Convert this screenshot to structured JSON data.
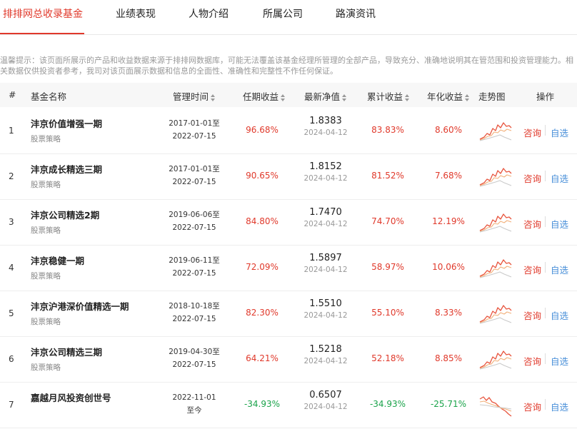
{
  "tabs": [
    {
      "label": "排排网总收录基金",
      "active": true
    },
    {
      "label": "业绩表现",
      "active": false
    },
    {
      "label": "人物介绍",
      "active": false
    },
    {
      "label": "所属公司",
      "active": false
    },
    {
      "label": "路演资讯",
      "active": false
    }
  ],
  "notice": {
    "line1": "温馨提示：该页面所展示的产品和收益数据来源于排排网数据库，可能无法覆盖该基金经理所管理的全部产品，导致充分、准确地说明其在管范围和投资管理能力。相",
    "line2": "关数据仅供投资者参考，我司对该页面展示数据和信息的全面性、准确性和完整性不作任何保证。"
  },
  "columns": {
    "index": "#",
    "fund_name": "基金名称",
    "period": "管理时间",
    "tenure_return": "任期收益",
    "nav": "最新净值",
    "cumulative": "累计收益",
    "annualized": "年化收益",
    "trend": "走势图",
    "action": "操作"
  },
  "colors": {
    "accent": "#e0392b",
    "up": "#e0392b",
    "down": "#1aa34a",
    "link": "#4a90d9"
  },
  "rows": [
    {
      "index": "1",
      "name": "沣京价值增强一期",
      "strategy": "股票策略",
      "start": "2017-01-01至",
      "end": "2022-07-15",
      "tenure": "96.68%",
      "nav": "1.8383",
      "nav_date": "2024-04-12",
      "cumulative": "83.83%",
      "annualized": "8.60%",
      "trend": "up",
      "consult": "咨询",
      "fav": "自选"
    },
    {
      "index": "2",
      "name": "沣京成长精选三期",
      "strategy": "股票策略",
      "start": "2017-01-01至",
      "end": "2022-07-15",
      "tenure": "90.65%",
      "nav": "1.8152",
      "nav_date": "2024-04-12",
      "cumulative": "81.52%",
      "annualized": "7.68%",
      "trend": "up",
      "consult": "咨询",
      "fav": "自选"
    },
    {
      "index": "3",
      "name": "沣京公司精选2期",
      "strategy": "股票策略",
      "start": "2019-06-06至",
      "end": "2022-07-15",
      "tenure": "84.80%",
      "nav": "1.7470",
      "nav_date": "2024-04-12",
      "cumulative": "74.70%",
      "annualized": "12.19%",
      "trend": "up",
      "consult": "咨询",
      "fav": "自选"
    },
    {
      "index": "4",
      "name": "沣京稳健一期",
      "strategy": "股票策略",
      "start": "2019-06-11至",
      "end": "2022-07-15",
      "tenure": "72.09%",
      "nav": "1.5897",
      "nav_date": "2024-04-12",
      "cumulative": "58.97%",
      "annualized": "10.06%",
      "trend": "up",
      "consult": "咨询",
      "fav": "自选"
    },
    {
      "index": "5",
      "name": "沣京沪港深价值精选一期",
      "strategy": "股票策略",
      "start": "2018-10-18至",
      "end": "2022-07-15",
      "tenure": "82.30%",
      "nav": "1.5510",
      "nav_date": "2024-04-12",
      "cumulative": "55.10%",
      "annualized": "8.33%",
      "trend": "up",
      "consult": "咨询",
      "fav": "自选"
    },
    {
      "index": "6",
      "name": "沣京公司精选三期",
      "strategy": "股票策略",
      "start": "2019-04-30至",
      "end": "2022-07-15",
      "tenure": "64.21%",
      "nav": "1.5218",
      "nav_date": "2024-04-12",
      "cumulative": "52.18%",
      "annualized": "8.85%",
      "trend": "up",
      "consult": "咨询",
      "fav": "自选"
    },
    {
      "index": "7",
      "name": "嘉越月风投资创世号",
      "strategy": "",
      "start": "2022-11-01",
      "end": "至今",
      "tenure": "-34.93%",
      "nav": "0.6507",
      "nav_date": "2024-04-12",
      "cumulative": "-34.93%",
      "annualized": "-25.71%",
      "trend": "down",
      "consult": "咨询",
      "fav": "自选"
    }
  ]
}
